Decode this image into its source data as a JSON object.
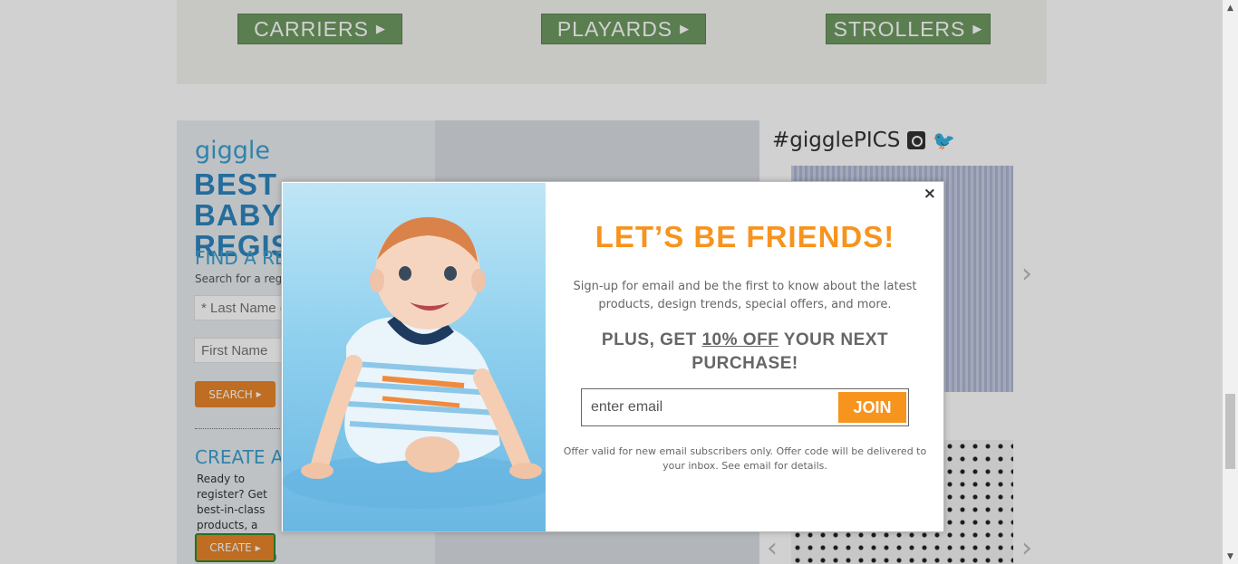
{
  "categories": [
    {
      "label": "CARRIERS"
    },
    {
      "label": "PLAYARDS"
    },
    {
      "label": "STROLLERS"
    }
  ],
  "registry": {
    "logo": "giggle",
    "title": "BEST BABY REGISTRY",
    "find_heading": "FIND A REGISTRY",
    "find_sub": "Search for a registry",
    "last_name_placeholder": "* Last Name (required)",
    "first_name_placeholder": "First Name",
    "search_label": "SEARCH",
    "create_heading": "CREATE A REGISTRY",
    "create_text": "Ready to register? Get best-in-class products, a registry discount and a",
    "create_label": "CREATE"
  },
  "instagram": {
    "heading": "#gigglePICS"
  },
  "modal": {
    "close": "×",
    "title": "LET’S BE FRIENDS!",
    "text": "Sign-up for email and be the first to know about the latest products, design trends, special offers, and more.",
    "plus_before": "PLUS, GET ",
    "plus_discount": "10% OFF",
    "plus_after": " YOUR NEXT PURCHASE!",
    "email_placeholder": "enter email",
    "join_label": "JOIN",
    "fine_print": "Offer valid for new email subscribers only. Offer code will be delivered to your inbox. See email for details."
  },
  "colors": {
    "accent": "#f7941d",
    "category_green": "#6f9a62",
    "registry_blue": "#2c86bf"
  }
}
